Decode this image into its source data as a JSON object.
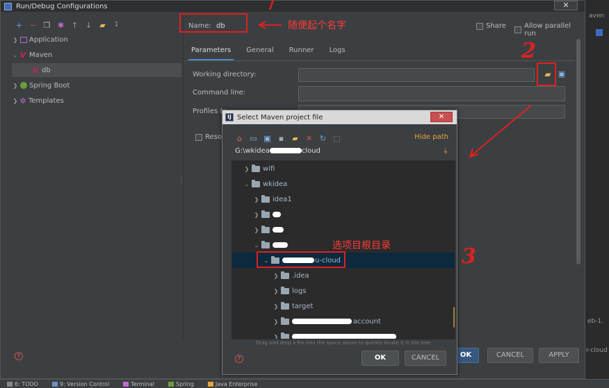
{
  "ide": {
    "right_fragments": [
      "aven",
      "eb-1.",
      "r-cloud"
    ],
    "statusbar": [
      "6: TODO",
      "9: Version Control",
      "Terminal",
      "Spring",
      "Java Enterprise"
    ]
  },
  "run_debug": {
    "title": "Run/Debug Configurations",
    "close_label": "✕",
    "toolbar_icons": [
      "plus-icon",
      "minus-icon",
      "copy-icon",
      "settings-icon",
      "arrow-up-icon",
      "arrow-down-icon",
      "folder-icon",
      "sort-icon"
    ],
    "tree": [
      {
        "label": "Application",
        "icon": "application-icon",
        "expanded": false
      },
      {
        "label": "Maven",
        "icon": "maven-icon",
        "expanded": true
      },
      {
        "label": "db",
        "icon": "maven-icon",
        "selected": true
      },
      {
        "label": "Spring Boot",
        "icon": "spring-boot-icon",
        "expanded": false
      },
      {
        "label": "Templates",
        "icon": "templates-gear-icon",
        "expanded": false
      }
    ],
    "name_label": "Name:",
    "name_value": "db",
    "share_label": "Share",
    "parallel_label": "Allow parallel run",
    "tabs": [
      "Parameters",
      "General",
      "Runner",
      "Logs"
    ],
    "active_tab": "Parameters",
    "working_directory_label": "Working directory:",
    "command_line_label": "Command line:",
    "profiles_label": "Profiles (s",
    "resolve_label": "Reso",
    "buttons": {
      "ok": "OK",
      "cancel": "CANCEL",
      "apply": "APPLY"
    }
  },
  "select_maven": {
    "title": "Select Maven project file",
    "close_label": "✕",
    "hide_path": "Hide path",
    "path_prefix": "G:\\wkidea",
    "path_suffix": "cloud",
    "tree": [
      {
        "label": "wifi",
        "expanded": false,
        "level": 1
      },
      {
        "label": "wkidea",
        "expanded": true,
        "level": 1
      },
      {
        "label": "idea1",
        "expanded": false,
        "level": 2
      },
      {
        "label": "",
        "expanded": false,
        "level": 2
      },
      {
        "label": "",
        "expanded": false,
        "level": 2
      },
      {
        "label": "",
        "expanded": true,
        "level": 2
      },
      {
        "label": "u-cloud",
        "expanded": true,
        "level": 3,
        "selected": true
      },
      {
        "label": ".idea",
        "expanded": false,
        "level": 4
      },
      {
        "label": "logs",
        "expanded": false,
        "level": 4
      },
      {
        "label": "target",
        "expanded": false,
        "level": 4
      },
      {
        "label": "account",
        "expanded": false,
        "level": 4
      },
      {
        "label": "",
        "expanded": false,
        "level": 4
      }
    ],
    "drag_hint": "Drag and drop a file into the space above to quickly locate it in the tree",
    "buttons": {
      "ok": "OK",
      "cancel": "CANCEL"
    }
  },
  "annotations": {
    "note_1": "随便起个名字",
    "note_3": "选项目根目录",
    "step_2": "2",
    "step_3": "3",
    "accent": "#e02020"
  }
}
